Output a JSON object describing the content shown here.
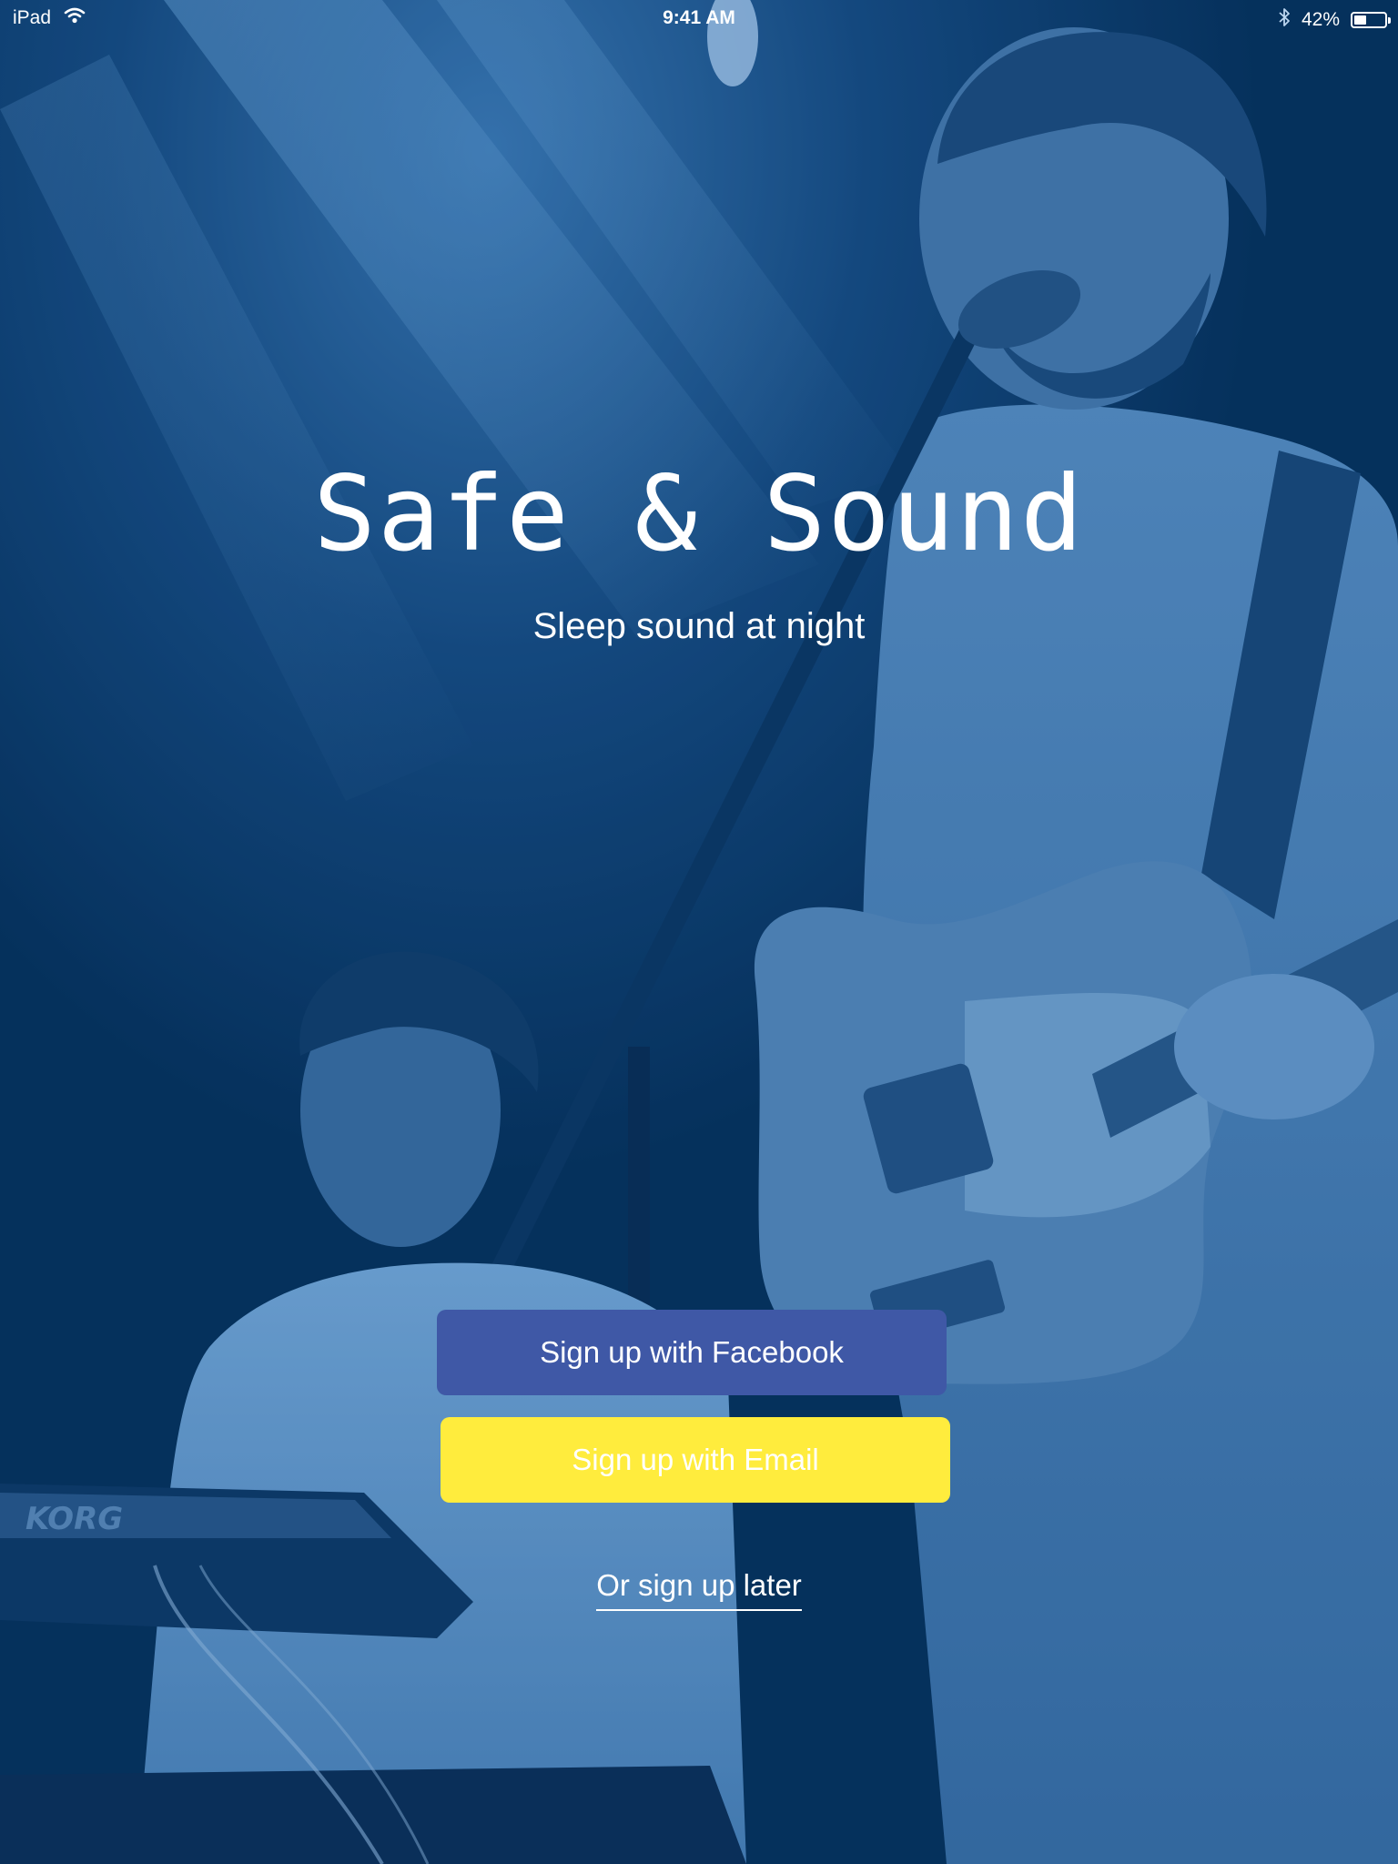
{
  "status_bar": {
    "device": "iPad",
    "time": "9:41 AM",
    "battery_percent": "42%",
    "battery_level": 0.42,
    "icons": [
      "wifi-icon",
      "bluetooth-icon",
      "battery-icon"
    ]
  },
  "hero": {
    "title": "Safe & Sound",
    "tagline": "Sleep sound at night"
  },
  "actions": {
    "facebook_label": "Sign up with Facebook",
    "email_label": "Sign up with Email",
    "later_label": "Or sign up later"
  },
  "colors": {
    "background_tint": "#06315c",
    "facebook_button": "#3f58a6",
    "email_button": "#ffec3d",
    "text": "#ffffff"
  }
}
